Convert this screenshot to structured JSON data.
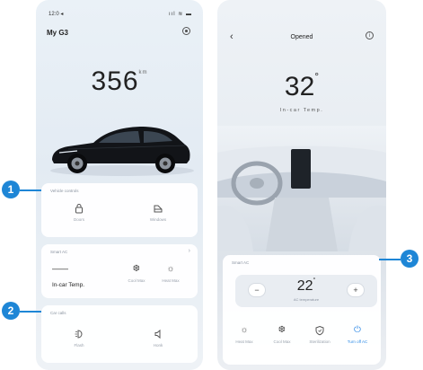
{
  "left_screen": {
    "status_time": "12:0 ◂",
    "status_icons": "ııl ≋ ▬",
    "title": "My G3",
    "range_value": "356",
    "range_unit": "km",
    "vehicle_controls": {
      "label": "Vehicle controls",
      "items": [
        {
          "label": "Doors",
          "icon": "lock-icon"
        },
        {
          "label": "Windows",
          "icon": "window-icon"
        }
      ]
    },
    "smart_ac": {
      "label": "Smart AC",
      "temp_value": "——",
      "temp_label": "In-car Temp.",
      "items": [
        {
          "label": "Cool Max",
          "icon": "fan-icon"
        },
        {
          "label": "Heat Max",
          "icon": "sun-icon"
        }
      ]
    },
    "car_calls": {
      "label": "Car calls",
      "items": [
        {
          "label": "Flash",
          "icon": "headlight-icon"
        },
        {
          "label": "Honk",
          "icon": "horn-icon"
        }
      ]
    }
  },
  "right_screen": {
    "back_icon": "‹",
    "title": "Opened",
    "info_icon": "i",
    "temp_value": "32",
    "temp_unit": "°",
    "temp_caption": "In-car Temp.",
    "smart_ac": {
      "label": "Smart AC",
      "minus": "−",
      "plus": "+",
      "setpoint": "22",
      "setpoint_unit": "°",
      "setpoint_caption": "AC temperature",
      "modes": [
        {
          "label": "Heat Max",
          "icon": "sun-icon"
        },
        {
          "label": "Cool Max",
          "icon": "fan-icon"
        },
        {
          "label": "Sterilization",
          "icon": "shield-icon"
        },
        {
          "label": "Turn off AC",
          "icon": "power-icon",
          "active": true
        }
      ]
    }
  },
  "callouts": [
    "1",
    "2",
    "3"
  ],
  "colors": {
    "callout": "#1e86d6",
    "active_mode": "#2e8ae6",
    "car_body": "#121418"
  }
}
